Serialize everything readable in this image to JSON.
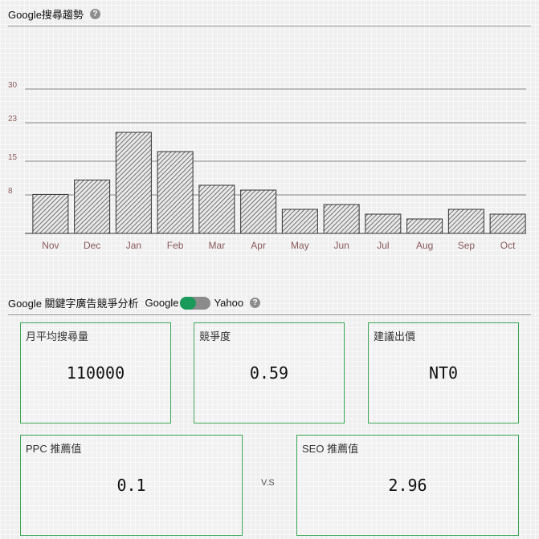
{
  "trend": {
    "title": "Google搜尋趨勢",
    "help_glyph": "?"
  },
  "chart_data": {
    "type": "bar",
    "categories": [
      "Nov",
      "Dec",
      "Jan",
      "Feb",
      "Mar",
      "Apr",
      "May",
      "Jun",
      "Jul",
      "Aug",
      "Sep",
      "Oct"
    ],
    "values": [
      8.1,
      11.1,
      21.0,
      17.0,
      10.0,
      9.0,
      5.0,
      6.0,
      4.0,
      3.0,
      5.0,
      4.0
    ],
    "yticks": [
      8,
      15,
      23,
      30
    ],
    "ylim": [
      0,
      30
    ],
    "title": "",
    "xlabel": "",
    "ylabel": "",
    "grid": true,
    "bar_fill": "hatched",
    "colors": {
      "bar_stroke": "#333333",
      "hatch": "#555555",
      "grid": "#666666",
      "tick_label": "#8b5a5a"
    }
  },
  "competition": {
    "title": "Google 關鍵字廣告競爭分析",
    "engine_left": "Google",
    "engine_right": "Yahoo",
    "help_glyph": "?"
  },
  "cards": {
    "monthly_searches": {
      "label": "月平均搜尋量",
      "value": "110000"
    },
    "competition": {
      "label": "競爭度",
      "value": "0.59"
    },
    "suggested_bid": {
      "label": "建議出價",
      "value": "NT0"
    },
    "ppc": {
      "label": "PPC 推薦值",
      "value": "0.1"
    },
    "vs": "V.S",
    "seo": {
      "label": "SEO 推薦值",
      "value": "2.96"
    }
  },
  "colors": {
    "card_border": "#3aa655",
    "toggle_on": "#1a9a5a",
    "toggle_off": "#8b8b8b"
  }
}
